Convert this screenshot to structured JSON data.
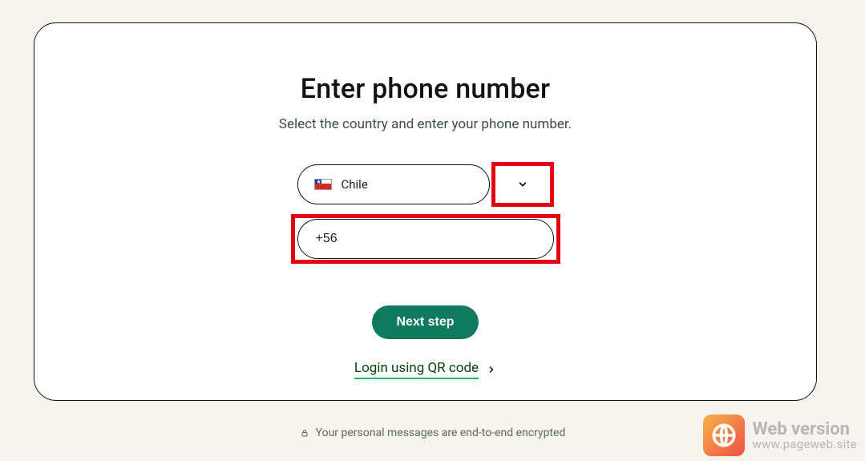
{
  "title": "Enter phone number",
  "subtitle": "Select the country and enter your phone number.",
  "country": {
    "selected_label": "Chile",
    "dial_code": "+56"
  },
  "next_button_label": "Next step",
  "qr_link_label": "Login using QR code",
  "footer_text": "Your personal messages are end-to-end encrypted",
  "watermark": {
    "line1": "Web version",
    "line2": "www.pageweb.site"
  },
  "colors": {
    "accent": "#0f7a5e",
    "highlight_border": "#e60012",
    "underline": "#1eb76e"
  }
}
